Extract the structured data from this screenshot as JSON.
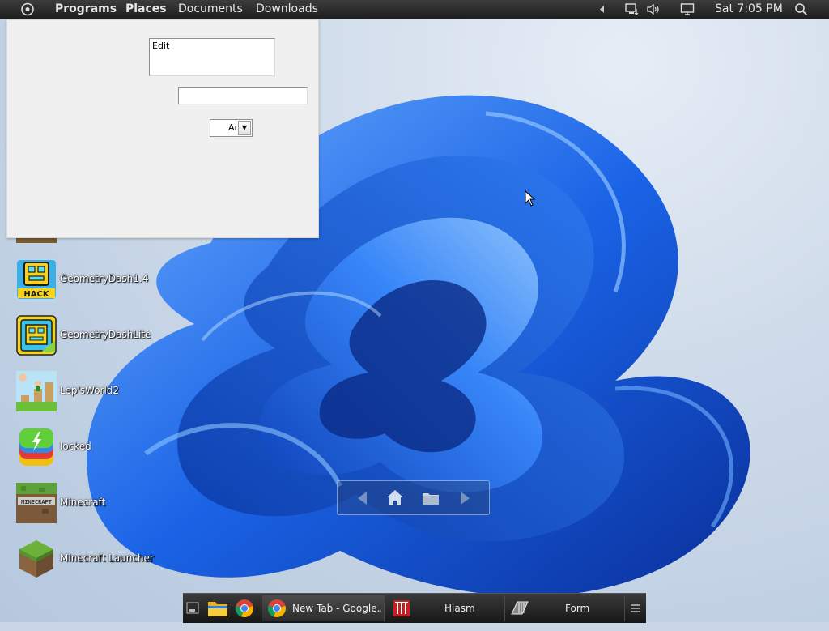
{
  "top_panel": {
    "menu": [
      "Programs",
      "Places",
      "Documents",
      "Downloads"
    ],
    "clock": "Sat 7:05 PM",
    "icons": [
      "menu-circle-icon",
      "collapse-arrow-icon",
      "network-icon",
      "volume-icon",
      "display-icon",
      "search-icon"
    ]
  },
  "form_window": {
    "memo_text": "Edit",
    "edit_value": "",
    "combo_value": "Ar"
  },
  "desktop_icons": [
    {
      "label": "GeometryDash1.4",
      "icon": "geometry-dash-hack-icon"
    },
    {
      "label": "GeometryDashLite",
      "icon": "geometry-dash-lite-icon"
    },
    {
      "label": "Lep'sWorld2",
      "icon": "leps-world-icon"
    },
    {
      "label": "locked",
      "icon": "locked-app-icon"
    },
    {
      "label": "Minecraft",
      "icon": "minecraft-icon"
    },
    {
      "label": "Minecraft Launcher",
      "icon": "minecraft-launcher-icon"
    }
  ],
  "nav_widget": {
    "buttons": [
      "back-arrow-icon",
      "home-icon",
      "folder-icon",
      "forward-arrow-icon"
    ]
  },
  "taskbar": {
    "launchers": [
      "show-desktop-icon",
      "file-manager-icon",
      "chrome-icon"
    ],
    "tasks": [
      {
        "label": "New Tab - Google...",
        "icon": "chrome-icon"
      },
      {
        "label": "Hiasm",
        "icon": "hiasm-icon"
      },
      {
        "label": "Form",
        "icon": "form-app-icon"
      }
    ],
    "menu_icon": "taskbar-menu-icon"
  },
  "colors": {
    "panel": "#2a2a2a",
    "wallpaper_bloom": "#1a5fe0",
    "form_bg": "#f0f0f0"
  }
}
